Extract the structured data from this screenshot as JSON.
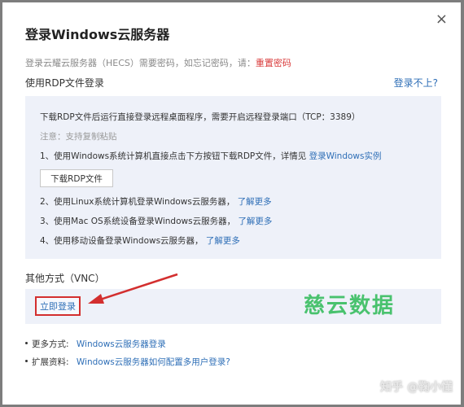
{
  "dialog": {
    "title": "登录Windows云服务器",
    "close_glyph": "×",
    "hint_text": "登录云耀云服务器（HECS）需要密码，如忘记密码，请：",
    "hint_link": "重置密码"
  },
  "rdp_section": {
    "label": "使用RDP文件登录",
    "help_link": "登录不上?",
    "intro": "下载RDP文件后运行直接登录远程桌面程序，需要开启远程登录端口（TCP：3389）",
    "note": "注意：支持复制粘贴",
    "item1_text": "1、使用Windows系统计算机直接点击下方按钮下载RDP文件，详情见",
    "item1_link": "登录Windows实例",
    "download_button": "下载RDP文件",
    "item2_text": "2、使用Linux系统计算机登录Windows云服务器，",
    "item2_link": "了解更多",
    "item3_text": "3、使用Mac OS系统设备登录Windows云服务器，",
    "item3_link": "了解更多",
    "item4_text": "4、使用移动设备登录Windows云服务器，",
    "item4_link": "了解更多"
  },
  "vnc_section": {
    "label": "其他方式（VNC）",
    "login_button": "立即登录"
  },
  "watermark": "慈云数据",
  "bullets": [
    {
      "label": "更多方式:",
      "link": "Windows云服务器登录"
    },
    {
      "label": "扩展资料:",
      "link": "Windows云服务器如何配置多用户登录?"
    }
  ],
  "corner_watermark": "知乎 @鞠小懂",
  "colors": {
    "accent_link": "#2f6fb7",
    "warning_red": "#d93c3c",
    "highlight_box": "#d32f2f",
    "watermark_green": "#49c26e",
    "panel_bg": "#eef1f9"
  }
}
